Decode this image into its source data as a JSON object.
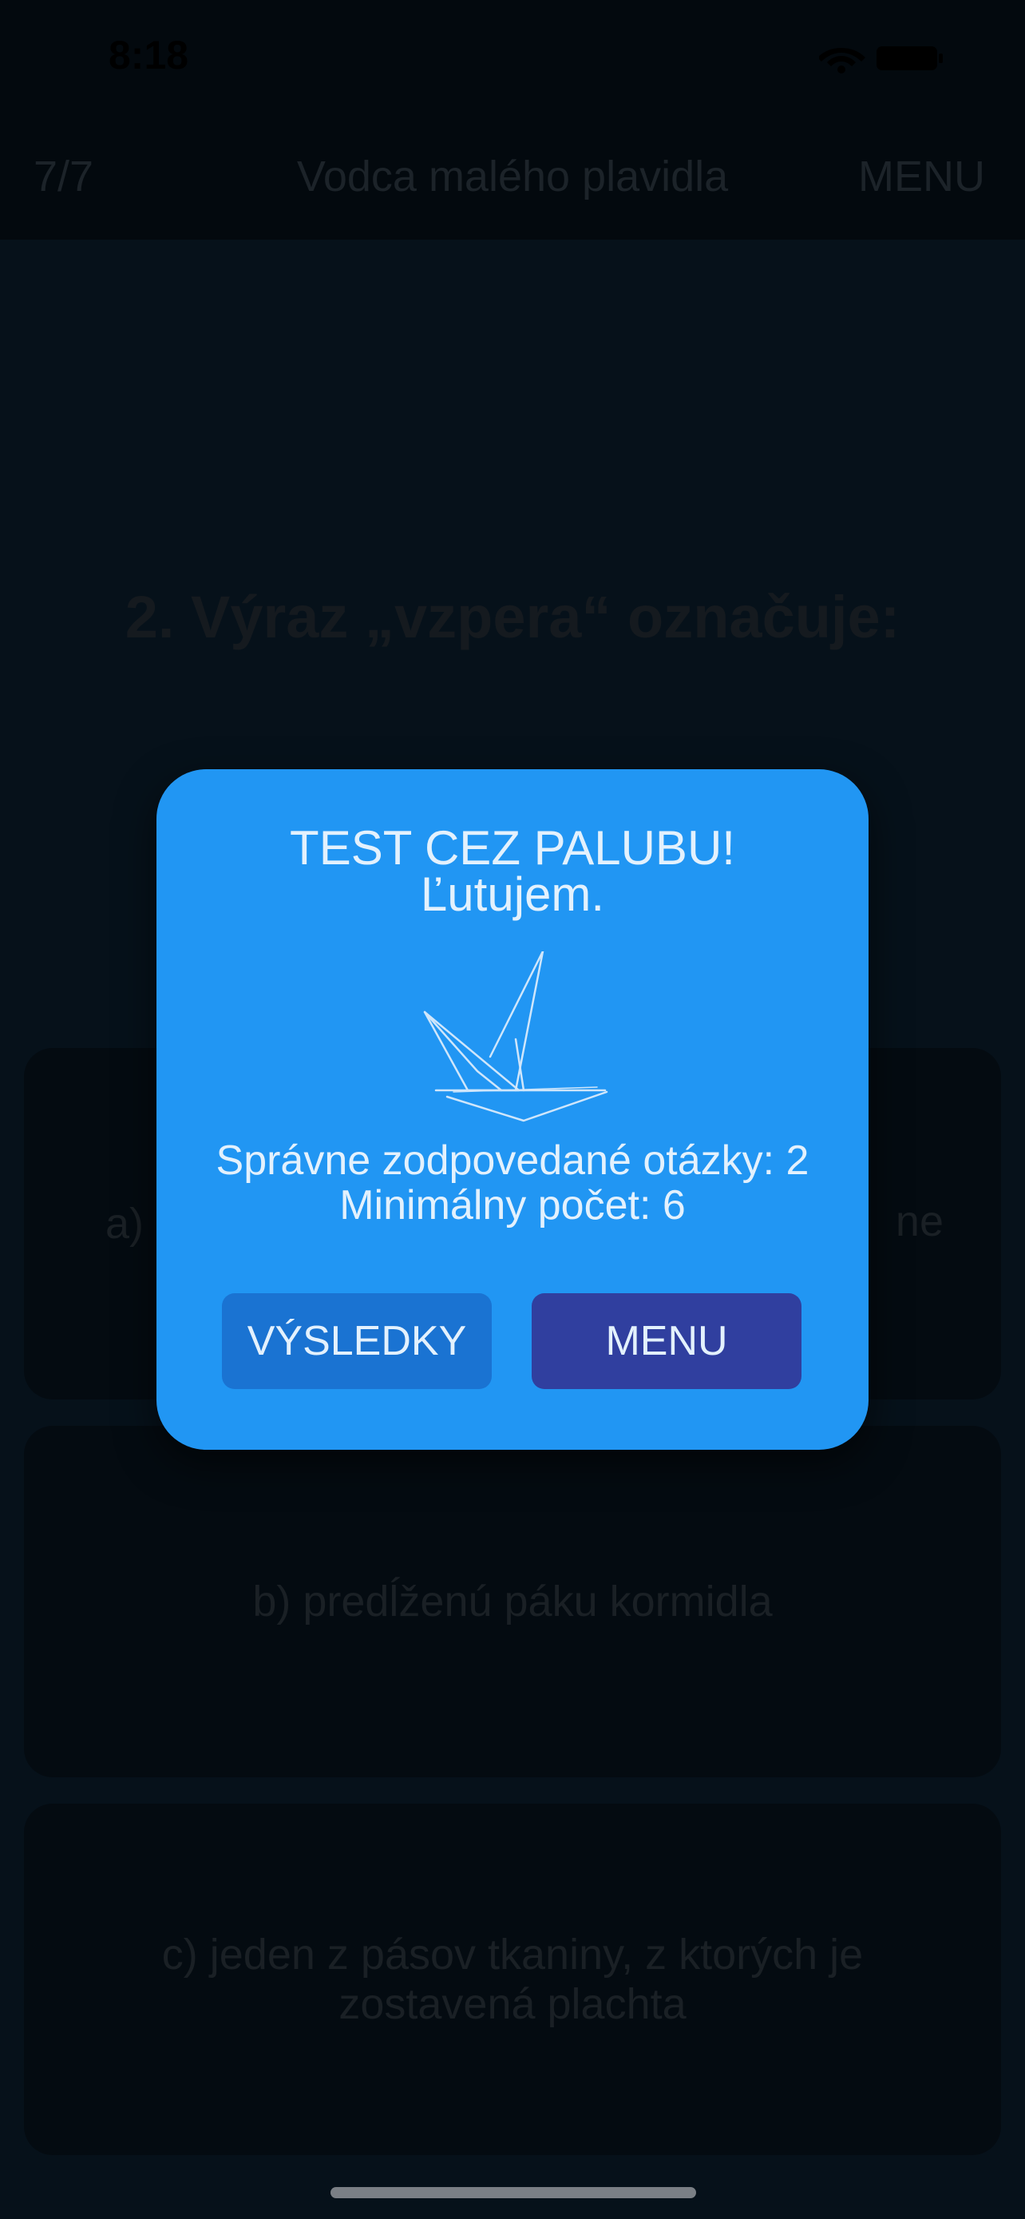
{
  "status_bar": {
    "time": "8:18",
    "icons": [
      "wifi-icon",
      "battery-icon"
    ]
  },
  "nav": {
    "counter": "7/7",
    "title": "Vodca malého plavidla",
    "menu_label": "MENU"
  },
  "question": {
    "text": "2. Výraz „vzpera“ označuje:"
  },
  "answers": {
    "a": {
      "prefix": "a)",
      "tail": "ne"
    },
    "b": {
      "text": "b) predĺženú páku kormidla"
    },
    "c": {
      "text": "c) jeden z pásov tkaniny, z ktorých je zostavená plachta"
    }
  },
  "dialog": {
    "title": "TEST CEZ PALUBU!",
    "subtitle": "Ľutujem.",
    "correct_text": "Správne zodpovedané otázky: 2",
    "minimum_text": "Minimálny počet: 6",
    "results_button": "VÝSLEDKY",
    "menu_button": "MENU"
  },
  "colors": {
    "dialog_bg": "#2196f3",
    "results_button_bg": "#1a73d2",
    "menu_button_bg": "#303f9f",
    "overlay_bg": "#06111a",
    "dialog_text": "#e3f1fd"
  }
}
